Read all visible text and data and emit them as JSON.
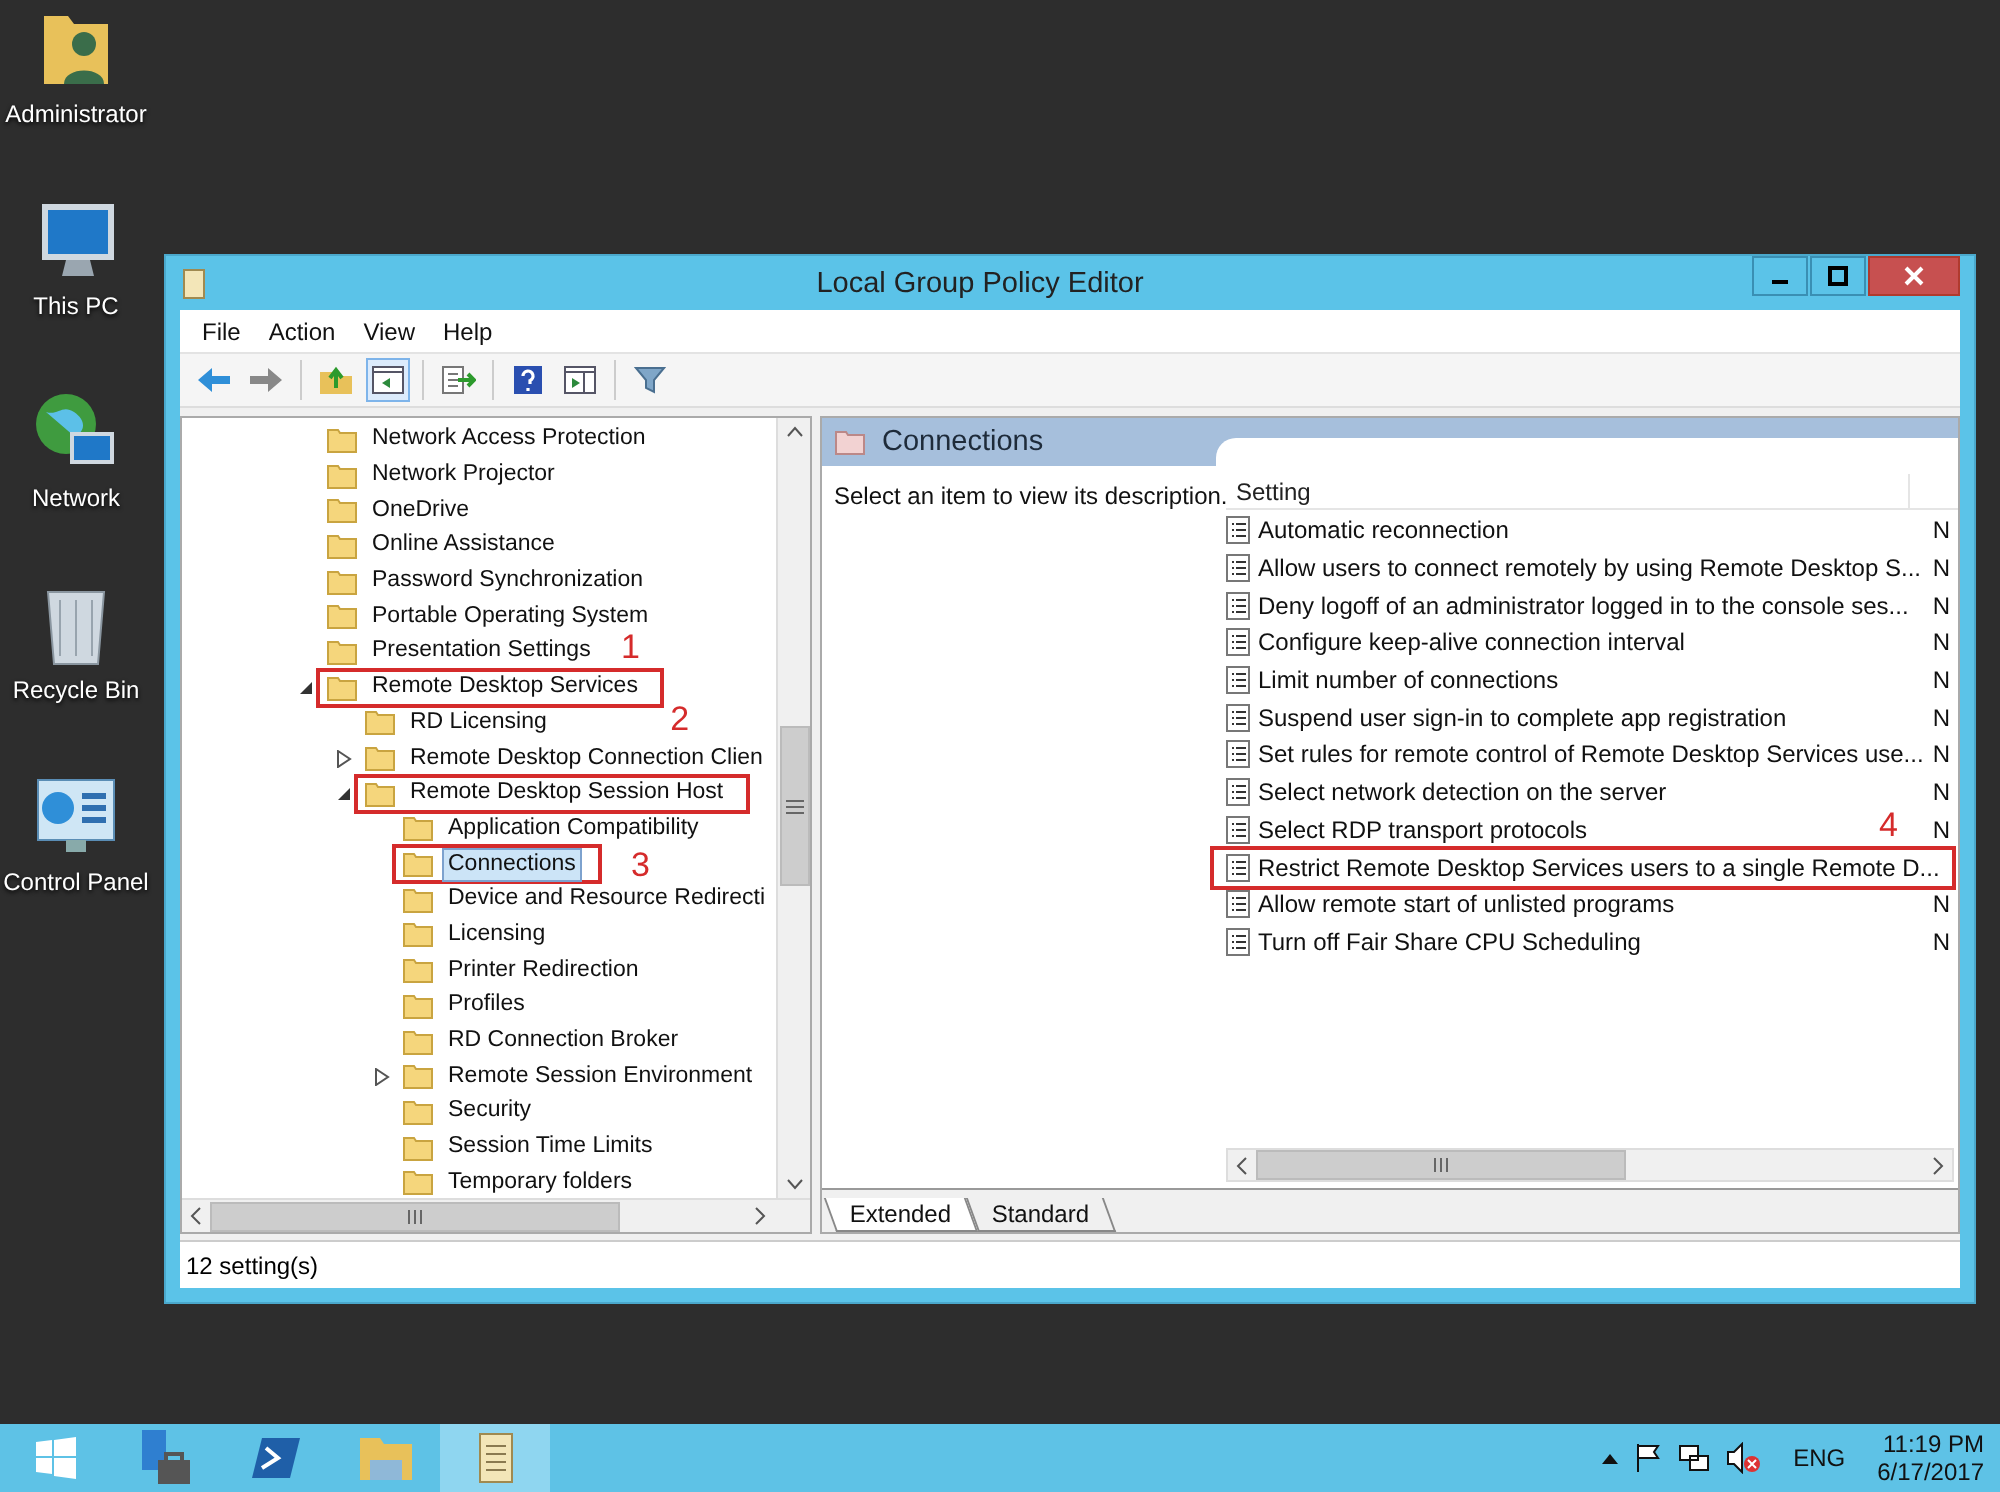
{
  "desktop_icons": [
    {
      "label": "Administrator",
      "kind": "user"
    },
    {
      "label": "This PC",
      "kind": "computer"
    },
    {
      "label": "Network",
      "kind": "network"
    },
    {
      "label": "Recycle Bin",
      "kind": "bin"
    },
    {
      "label": "Control Panel",
      "kind": "panel"
    }
  ],
  "window": {
    "title": "Local Group Policy Editor"
  },
  "menu": [
    "File",
    "Action",
    "View",
    "Help"
  ],
  "tree": [
    {
      "label": "Network Access Protection",
      "selected": false
    },
    {
      "label": "Network Projector",
      "selected": false
    },
    {
      "label": "OneDrive",
      "selected": false
    },
    {
      "label": "Online Assistance",
      "selected": false
    },
    {
      "label": "Password Synchronization",
      "selected": false
    },
    {
      "label": "Portable Operating System",
      "selected": false
    },
    {
      "label": "Presentation Settings",
      "selected": false
    },
    {
      "label": "Remote Desktop Services",
      "expanded": true,
      "selected": false,
      "annotation": "1",
      "children": [
        {
          "label": "RD Licensing",
          "selected": false
        },
        {
          "label": "Remote Desktop Connection Clien",
          "expanded": false,
          "selected": false
        },
        {
          "label": "Remote Desktop Session Host",
          "expanded": true,
          "selected": false,
          "annotation": "2",
          "children": [
            {
              "label": "Application Compatibility",
              "selected": false
            },
            {
              "label": "Connections",
              "selected": true,
              "annotation": "3"
            },
            {
              "label": "Device and Resource Redirecti",
              "selected": false
            },
            {
              "label": "Licensing",
              "selected": false
            },
            {
              "label": "Printer Redirection",
              "selected": false
            },
            {
              "label": "Profiles",
              "selected": false
            },
            {
              "label": "RD Connection Broker",
              "selected": false
            },
            {
              "label": "Remote Session Environment",
              "expanded": false,
              "selected": false
            },
            {
              "label": "Security",
              "selected": false
            },
            {
              "label": "Session Time Limits",
              "selected": false
            },
            {
              "label": "Temporary folders",
              "selected": false
            }
          ]
        }
      ]
    }
  ],
  "details": {
    "title": "Connections",
    "description": "Select an item to view its description.",
    "columns": [
      "Setting"
    ],
    "rows": [
      {
        "setting": "Automatic reconnection",
        "column_2": "N"
      },
      {
        "setting": "Allow users to connect remotely by using Remote Desktop S...",
        "column_2": "N"
      },
      {
        "setting": "Deny logoff of an administrator logged in to the console ses...",
        "column_2": "N"
      },
      {
        "setting": "Configure keep-alive connection interval",
        "column_2": "N"
      },
      {
        "setting": "Limit number of connections",
        "column_2": "N"
      },
      {
        "setting": "Suspend user sign-in to complete app registration",
        "column_2": "N"
      },
      {
        "setting": "Set rules for remote control of Remote Desktop Services use...",
        "column_2": "N"
      },
      {
        "setting": "Select network detection on the server",
        "column_2": "N"
      },
      {
        "setting": "Select RDP transport protocols",
        "column_2": "N"
      },
      {
        "setting": "Restrict Remote Desktop Services users to a single Remote D...",
        "annotation": "4"
      },
      {
        "setting": "Allow remote start of unlisted programs",
        "column_2": "N"
      },
      {
        "setting": "Turn off Fair Share CPU Scheduling",
        "column_2": "N"
      }
    ],
    "tabs": [
      {
        "label": "Extended",
        "selected": true
      },
      {
        "label": "Standard",
        "selected": false
      }
    ]
  },
  "status_bar": "12 setting(s)",
  "taskbar": {
    "language": "ENG",
    "time": "11:19 PM",
    "date": "6/17/2017"
  }
}
